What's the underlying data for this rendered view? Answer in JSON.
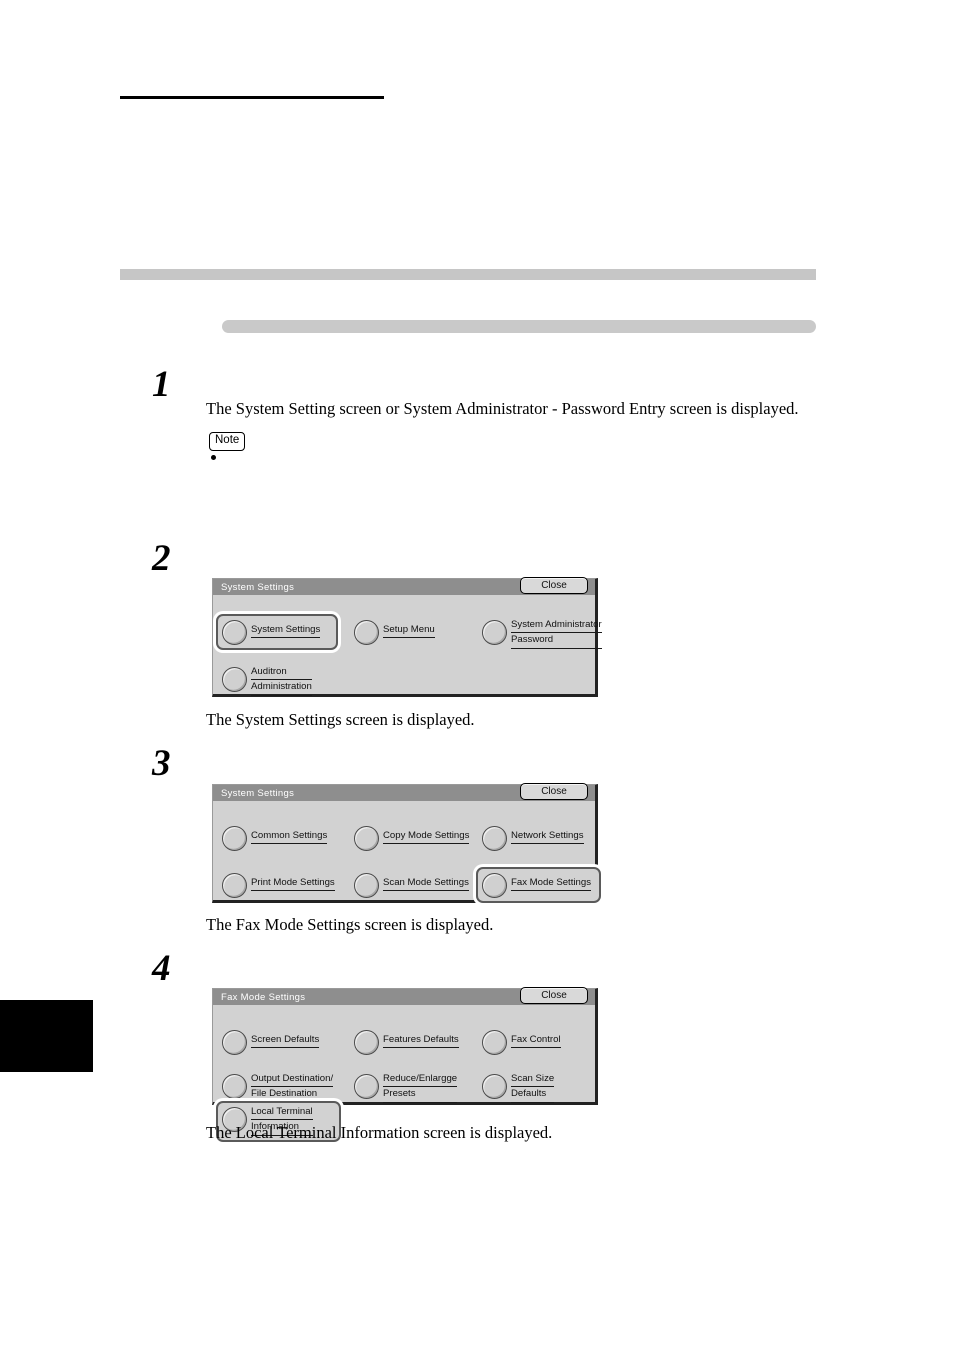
{
  "page": {
    "thumb_tab": "page-edge-tab"
  },
  "steps": [
    {
      "number": "1",
      "text": "The System Setting screen or System Administrator - Password Entry screen is displayed.",
      "note_label": "Note"
    },
    {
      "number": "2",
      "caption": "The System Settings screen is displayed."
    },
    {
      "number": "3",
      "caption": "The Fax Mode Settings screen is displayed."
    },
    {
      "number": "4",
      "caption": "The Local Terminal Information screen is displayed."
    }
  ],
  "panels": [
    {
      "title": "System Settings",
      "close_label": "Close",
      "items": [
        {
          "lines": [
            "System Settings"
          ],
          "selected": true,
          "col": 0,
          "row": 0
        },
        {
          "lines": [
            "Setup Menu"
          ],
          "selected": false,
          "col": 1,
          "row": 0
        },
        {
          "lines": [
            "System Administrator",
            "Password"
          ],
          "selected": false,
          "col": 2,
          "row": 0
        },
        {
          "lines": [
            "Auditron",
            "Administration"
          ],
          "selected": false,
          "col": 0,
          "row": 1
        }
      ]
    },
    {
      "title": "System Settings",
      "close_label": "Close",
      "items": [
        {
          "lines": [
            "Common Settings"
          ],
          "selected": false,
          "col": 0,
          "row": 0
        },
        {
          "lines": [
            "Copy Mode Settings"
          ],
          "selected": false,
          "col": 1,
          "row": 0
        },
        {
          "lines": [
            "Network Settings"
          ],
          "selected": false,
          "col": 2,
          "row": 0
        },
        {
          "lines": [
            "Print Mode Settings"
          ],
          "selected": false,
          "col": 0,
          "row": 1
        },
        {
          "lines": [
            "Scan Mode Settings"
          ],
          "selected": false,
          "col": 1,
          "row": 1
        },
        {
          "lines": [
            "Fax Mode Settings"
          ],
          "selected": true,
          "col": 2,
          "row": 1
        }
      ]
    },
    {
      "title": "Fax Mode Settings",
      "close_label": "Close",
      "items": [
        {
          "lines": [
            "Screen Defaults"
          ],
          "selected": false,
          "col": 0,
          "row": 0
        },
        {
          "lines": [
            "Features Defaults"
          ],
          "selected": false,
          "col": 1,
          "row": 0
        },
        {
          "lines": [
            "Fax Control"
          ],
          "selected": false,
          "col": 2,
          "row": 0
        },
        {
          "lines": [
            "Output Destination/",
            "File Destination"
          ],
          "selected": false,
          "col": 0,
          "row": 1
        },
        {
          "lines": [
            "Reduce/Enlargge",
            "Presets"
          ],
          "selected": false,
          "col": 1,
          "row": 1
        },
        {
          "lines": [
            "Scan Size",
            "Defaults"
          ],
          "selected": false,
          "col": 2,
          "row": 1
        },
        {
          "lines": [
            "Local Terminal",
            "Information"
          ],
          "selected": true,
          "col": 0,
          "row": 2
        }
      ]
    }
  ],
  "colors": {
    "panel_bg": "#d2d2d2",
    "titlebar": "#8e8e8e",
    "rule": "#c6c6c6",
    "selected_border": "#5a5a5a"
  }
}
